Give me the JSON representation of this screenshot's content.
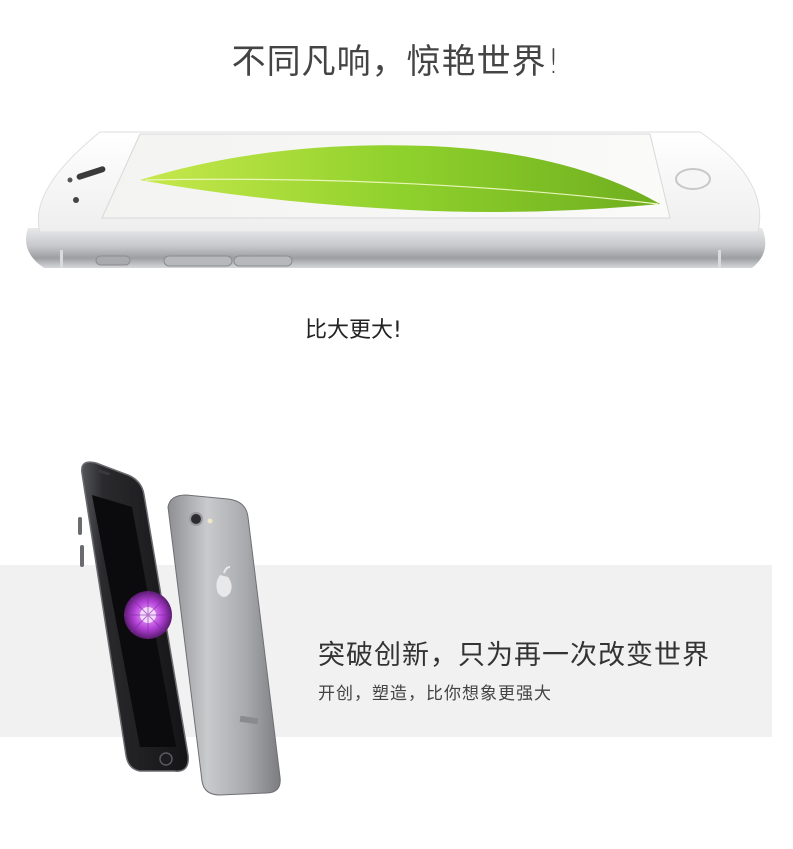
{
  "hero": {
    "headline": "不同凡响，惊艳世界!",
    "subhead": "比大更大!"
  },
  "feature": {
    "title": "突破创新，只为再一次改变世界",
    "subtitle": "开创，塑造，比你想象更强大"
  },
  "images": {
    "phone_side": "white-phone-side-leaf-image",
    "phones_angle": "space-gray-phones-front-back-image"
  },
  "colors": {
    "band": "#f1f1f1",
    "leaf": "#8fd12c",
    "phone_silver": "#c9cacc",
    "phone_dark": "#1a1a1d",
    "flower": "#b23fd6"
  }
}
